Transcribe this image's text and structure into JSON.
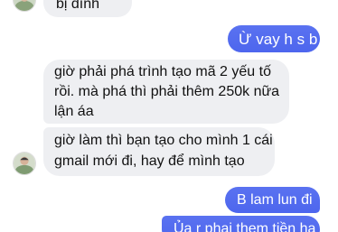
{
  "conversation": {
    "messages": [
      {
        "id": "m0",
        "sender": "other",
        "text": "bị đình"
      },
      {
        "id": "m1",
        "sender": "me",
        "text": "Ừ vay h s b"
      },
      {
        "id": "m2",
        "sender": "other",
        "lines": [
          "giờ phải phá trình tạo mã 2 yếu tố",
          "rồi. mà phá thì phải thêm 250k nữa",
          "lận áa"
        ]
      },
      {
        "id": "m3",
        "sender": "other",
        "lines": [
          "giờ làm thì bạn tạo cho mình 1 cái",
          "gmail mới đi, hay để mình tạo"
        ]
      },
      {
        "id": "m4",
        "sender": "me",
        "text": "B lam lun đi"
      },
      {
        "id": "m5",
        "sender": "me",
        "text": "Ủa r phai them tiền ha"
      }
    ]
  },
  "colors": {
    "incoming_bubble": "#eeeff2",
    "outgoing_bubble": "#5169ef",
    "text_dark": "#111111",
    "text_light": "#ffffff"
  },
  "icons": {
    "avatar": "contact-avatar-icon"
  }
}
